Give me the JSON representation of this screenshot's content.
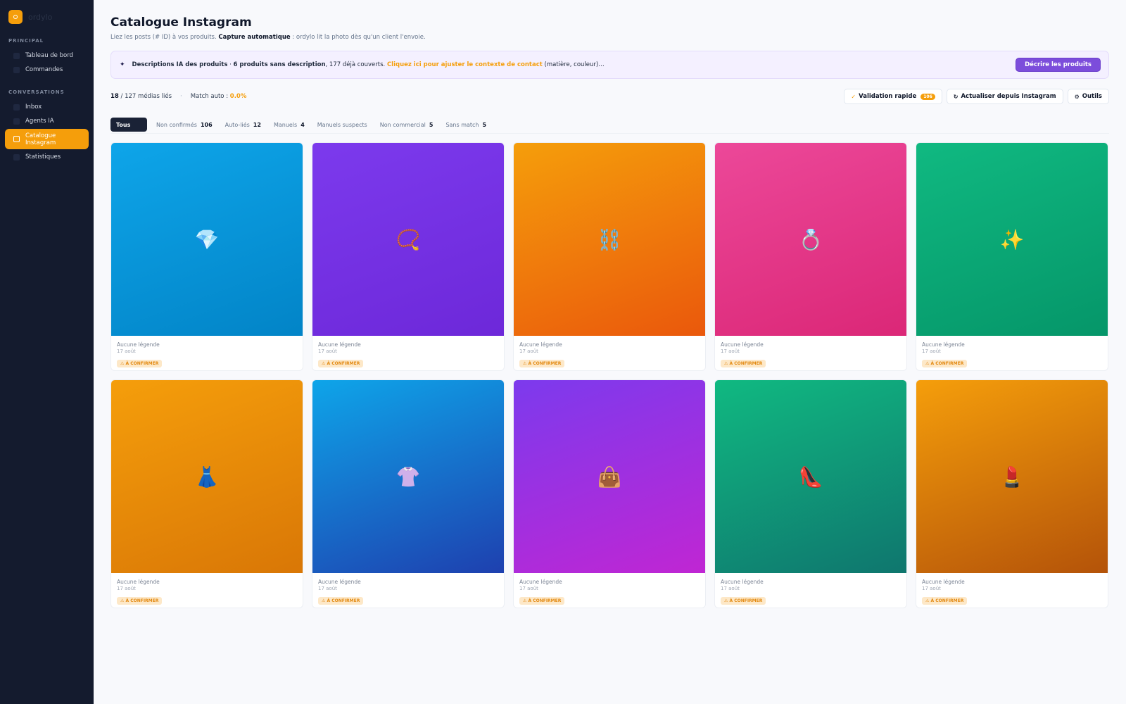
{
  "app": {
    "brand": "ordylo"
  },
  "sidebar": {
    "sections": [
      {
        "label": "PRINCIPAL",
        "items": [
          {
            "label": "Tableau de bord"
          },
          {
            "label": "Commandes"
          }
        ]
      },
      {
        "label": "CONVERSATIONS",
        "items": [
          {
            "label": "Inbox"
          },
          {
            "label": "Agents IA"
          },
          {
            "label": "Catalogue\nInstagram",
            "active": true
          },
          {
            "label": "Statistiques"
          }
        ]
      }
    ]
  },
  "header": {
    "title": "Catalogue Instagram",
    "subtitle_prefix": "Liez les posts (# ID) à vos produits. ",
    "subtitle_bold": "Capture automatique",
    "subtitle_suffix": " : ordylo lit la photo dès qu'un client l'envoie."
  },
  "ai_banner": {
    "icon": "sparkle-icon",
    "title": "Descriptions IA des produits",
    "sep": " · ",
    "missing": "6 produits sans description",
    "covered": ", 177 déjà couverts. ",
    "link": "Cliquez ici pour ajuster le contexte de contact",
    "suffix": " (matière, couleur)…",
    "button": "Décrire les produits"
  },
  "stats": {
    "linked": "18",
    "total": " / 127 médias liés",
    "dot": "·",
    "match_label": "Match auto : ",
    "match_value": "0.0%"
  },
  "toolbar": {
    "validation": {
      "label": "Validation rapide",
      "count": "106",
      "icon": "check-icon"
    },
    "refresh": {
      "label": "Actualiser depuis Instagram",
      "icon": "refresh-icon"
    },
    "tools": {
      "label": "Outils",
      "icon": "gear-icon"
    }
  },
  "filters": [
    {
      "label": "Tous",
      "count": "",
      "active": true
    },
    {
      "label": "Non confirmés",
      "count": "106"
    },
    {
      "label": "Auto-liés",
      "count": "12"
    },
    {
      "label": "Manuels",
      "count": "4"
    },
    {
      "label": "Manuels suspects",
      "count": ""
    },
    {
      "label": "Non commercial",
      "count": "5"
    },
    {
      "label": "Sans match",
      "count": "5"
    }
  ],
  "cards": [
    {
      "emoji": "💎",
      "icon": "gem-icon",
      "caption": "Aucune légende",
      "date": "17 août",
      "status": "⚠ À CONFIRMER",
      "colors": [
        "#0ea5e9",
        "#0284c7"
      ]
    },
    {
      "emoji": "📿",
      "icon": "beads-icon",
      "caption": "Aucune légende",
      "date": "17 août",
      "status": "⚠ À CONFIRMER",
      "colors": [
        "#7c3aed",
        "#6d28d9"
      ]
    },
    {
      "emoji": "⛓️",
      "icon": "chain-icon",
      "caption": "Aucune légende",
      "date": "17 août",
      "status": "⚠ À CONFIRMER",
      "colors": [
        "#f59e0b",
        "#ea580c"
      ]
    },
    {
      "emoji": "💍",
      "icon": "ring-icon",
      "caption": "Aucune légende",
      "date": "17 août",
      "status": "⚠ À CONFIRMER",
      "colors": [
        "#ec4899",
        "#db2777"
      ]
    },
    {
      "emoji": "✨",
      "icon": "sparkles-icon",
      "caption": "Aucune légende",
      "date": "17 août",
      "status": "⚠ À CONFIRMER",
      "colors": [
        "#10b981",
        "#059669"
      ]
    },
    {
      "emoji": "👗",
      "icon": "dress-icon",
      "caption": "Aucune légende",
      "date": "17 août",
      "status": "⚠ À CONFIRMER",
      "colors": [
        "#f59e0b",
        "#d97706"
      ]
    },
    {
      "emoji": "👚",
      "icon": "blouse-icon",
      "caption": "Aucune légende",
      "date": "17 août",
      "status": "⚠ À CONFIRMER",
      "colors": [
        "#0ea5e9",
        "#1e40af"
      ]
    },
    {
      "emoji": "👜",
      "icon": "handbag-icon",
      "caption": "Aucune légende",
      "date": "17 août",
      "status": "⚠ À CONFIRMER",
      "colors": [
        "#7c3aed",
        "#c026d3"
      ]
    },
    {
      "emoji": "👠",
      "icon": "heel-icon",
      "caption": "Aucune légende",
      "date": "17 août",
      "status": "⚠ À CONFIRMER",
      "colors": [
        "#10b981",
        "#0f766e"
      ]
    },
    {
      "emoji": "💄",
      "icon": "lipstick-icon",
      "caption": "Aucune légende",
      "date": "17 août",
      "status": "⚠ À CONFIRMER",
      "colors": [
        "#f59e0b",
        "#b45309"
      ]
    }
  ]
}
